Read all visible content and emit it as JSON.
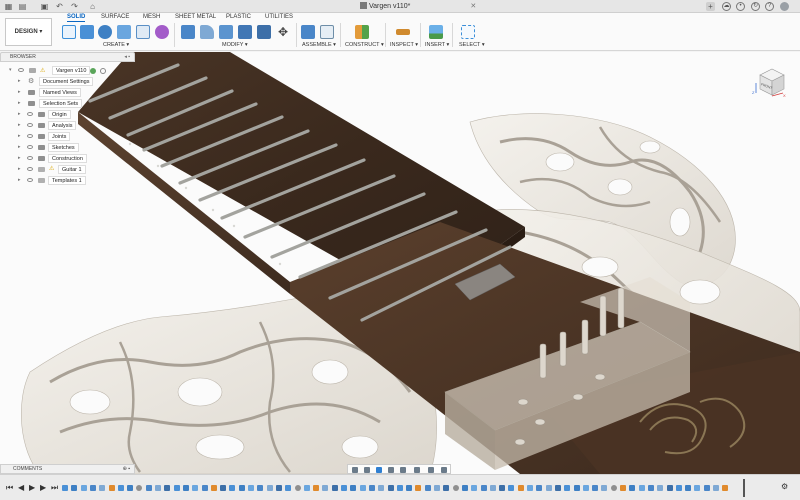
{
  "window": {
    "doc_title": "Vargen v110*",
    "icons": [
      "grid-icon",
      "file-icon",
      "save-icon",
      "undo-icon",
      "redo-icon",
      "home-icon",
      "close-icon",
      "add-tab-icon",
      "cloud-icon",
      "notifications-icon",
      "job-status-icon",
      "help-icon",
      "user-avatar"
    ]
  },
  "ribbon": {
    "workspace_label": "DESIGN ▾",
    "tabs": [
      {
        "label": "SOLID",
        "active": true
      },
      {
        "label": "SURFACE",
        "active": false
      },
      {
        "label": "MESH",
        "active": false
      },
      {
        "label": "SHEET METAL",
        "active": false
      },
      {
        "label": "PLASTIC",
        "active": false
      },
      {
        "label": "UTILITIES",
        "active": false
      }
    ],
    "groups": [
      {
        "label": "CREATE ▾"
      },
      {
        "label": "MODIFY ▾"
      },
      {
        "label": "ASSEMBLE ▾"
      },
      {
        "label": "CONSTRUCT ▾"
      },
      {
        "label": "INSPECT ▾"
      },
      {
        "label": "INSERT ▾"
      },
      {
        "label": "SELECT ▾"
      }
    ]
  },
  "browser": {
    "header": "BROWSER",
    "root": "Vargen v110",
    "items": [
      {
        "label": "Document Settings",
        "icon": "gear-icon"
      },
      {
        "label": "Named Views",
        "icon": "folder-icon"
      },
      {
        "label": "Selection Sets",
        "icon": "folder-icon"
      },
      {
        "label": "Origin",
        "icon": "folder-icon"
      },
      {
        "label": "Analysis",
        "icon": "folder-icon"
      },
      {
        "label": "Joints",
        "icon": "folder-icon"
      },
      {
        "label": "Sketches",
        "icon": "folder-icon"
      },
      {
        "label": "Construction",
        "icon": "folder-icon"
      },
      {
        "label": "Guitar 1",
        "icon": "component-icon"
      },
      {
        "label": "Templates 1",
        "icon": "component-icon"
      }
    ]
  },
  "viewcube": {
    "face_label": "FRONT",
    "axis_z": "Z",
    "axis_x": "X"
  },
  "comments": {
    "label": "COMMENTS"
  },
  "colors": {
    "accent": "#0a66c2",
    "wood_dark": "#3b2a1e",
    "wood_mid": "#5a3f2b",
    "lattice": "#eae6df",
    "fret": "#9a9a96"
  }
}
